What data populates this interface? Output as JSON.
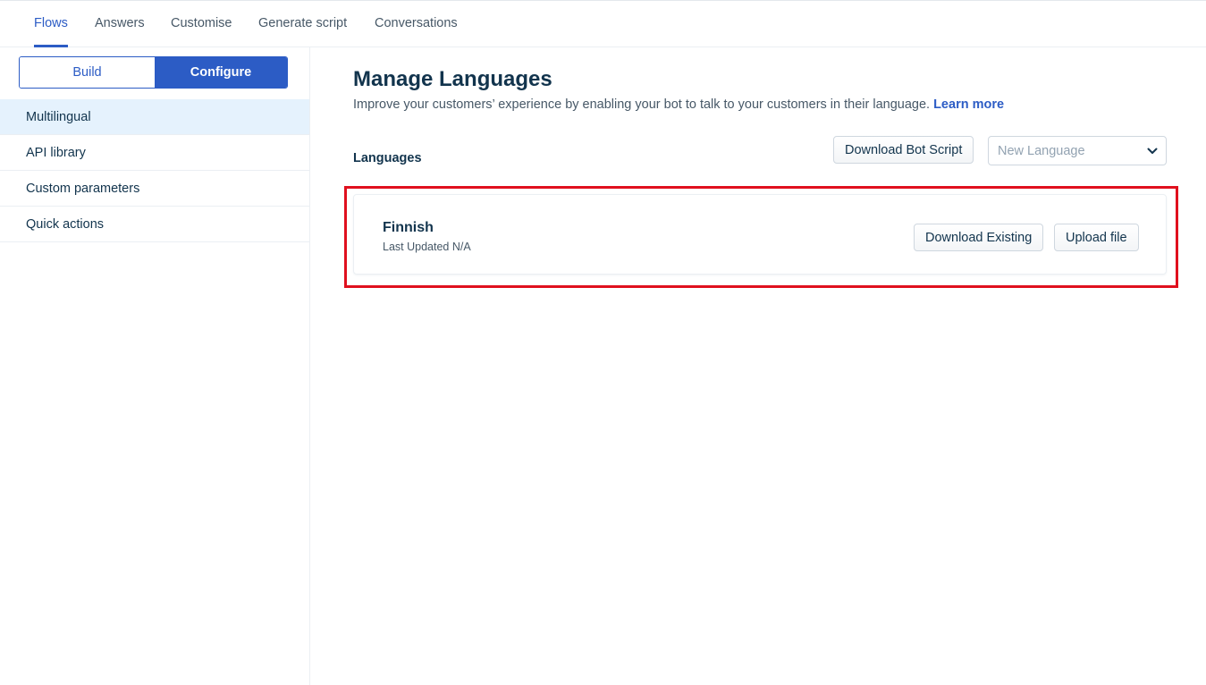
{
  "nav": {
    "tabs": [
      {
        "label": "Flows",
        "active": true
      },
      {
        "label": "Answers"
      },
      {
        "label": "Customise"
      },
      {
        "label": "Generate script"
      },
      {
        "label": "Conversations"
      }
    ]
  },
  "sidebar": {
    "toggle": {
      "build": "Build",
      "configure": "Configure",
      "selected": "Configure"
    },
    "items": [
      {
        "label": "Multilingual",
        "active": true
      },
      {
        "label": "API library"
      },
      {
        "label": "Custom parameters"
      },
      {
        "label": "Quick actions"
      }
    ]
  },
  "main": {
    "title": "Manage Languages",
    "description": "Improve your customers’ experience by enabling your bot to talk to your customers in their language.",
    "learn_more": "Learn more",
    "section_label": "Languages",
    "download_bot_script": "Download Bot Script",
    "new_language_placeholder": "New Language",
    "languages": [
      {
        "name": "Finnish",
        "last_updated": "Last Updated N/A",
        "download_label": "Download Existing",
        "upload_label": "Upload file"
      }
    ]
  },
  "colors": {
    "accent": "#2c5cc5",
    "highlight": "#e0101e",
    "active_bg": "#e5f2fd",
    "text": "#12344d"
  },
  "icons": {
    "select_toggle": "chevron-down-icon"
  }
}
